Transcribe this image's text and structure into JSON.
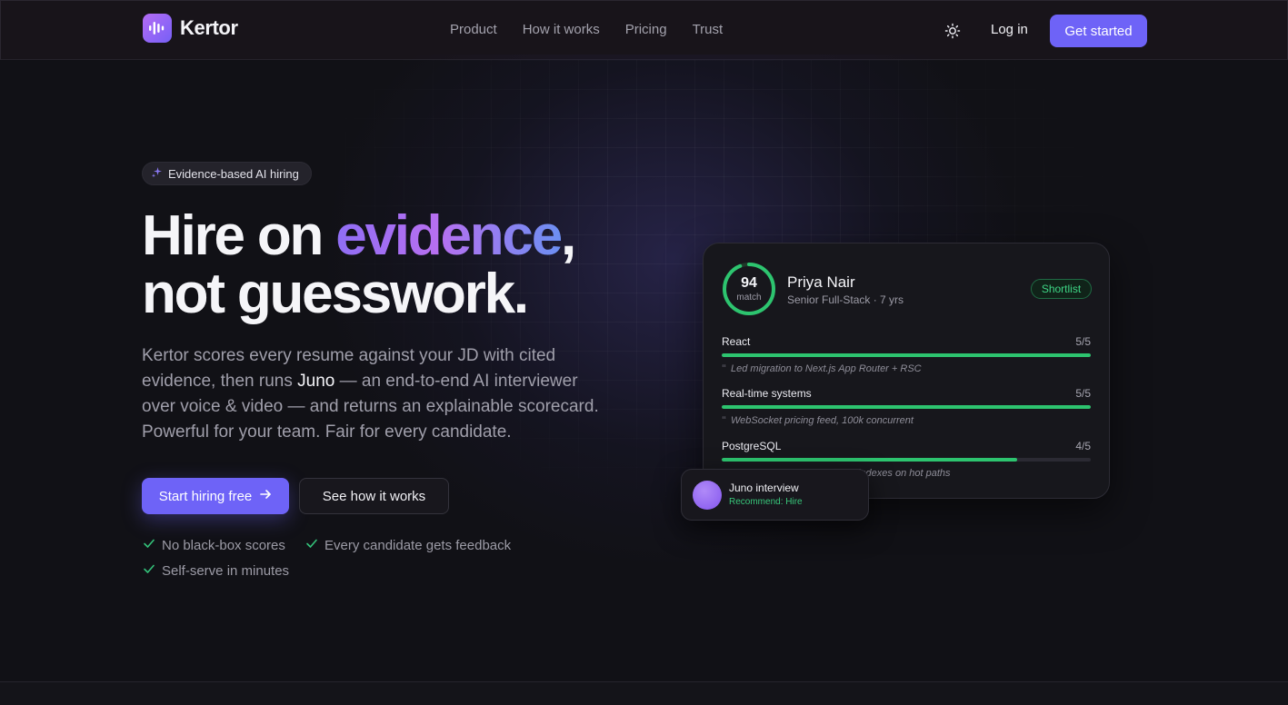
{
  "brand": {
    "name": "Kertor"
  },
  "nav": {
    "links": [
      "Product",
      "How it works",
      "Pricing",
      "Trust"
    ],
    "login": "Log in",
    "cta": "Get started"
  },
  "hero": {
    "badge": "Evidence-based AI hiring",
    "headline": {
      "part1": "Hire on ",
      "highlight": "evidence",
      "part2": ",",
      "line2": "not guesswork."
    },
    "lede": {
      "before": "Kertor scores every resume against your JD with cited evidence, then runs ",
      "strong": "Juno",
      "after": " — an end-to-end AI interviewer over voice & video — and returns an explainable scorecard. Powerful for your team. Fair for every candidate."
    },
    "primary_cta": "Start hiring free",
    "secondary_cta": "See how it works",
    "checks": [
      "No black-box scores",
      "Every candidate gets feedback",
      "Self-serve in minutes"
    ]
  },
  "scorecard": {
    "score": "94",
    "score_fraction": 0.94,
    "score_label": "match",
    "name": "Priya Nair",
    "role": "Senior Full-Stack · 7 yrs",
    "status": "Shortlist",
    "skills": [
      {
        "name": "React",
        "score": "5/5",
        "fraction": 1.0,
        "evidence": "Led migration to Next.js App Router + RSC"
      },
      {
        "name": "Real-time systems",
        "score": "5/5",
        "fraction": 1.0,
        "evidence": "WebSocket pricing feed, 100k concurrent"
      },
      {
        "name": "PostgreSQL",
        "score": "4/5",
        "fraction": 0.8,
        "evidence": "indexes on hot paths"
      }
    ]
  },
  "juno_card": {
    "title": "Juno interview",
    "recommendation": "Recommend: Hire"
  },
  "colors": {
    "accent": "#6e63f7",
    "success": "#2dc46f",
    "background": "#111116"
  },
  "icons": {
    "logo": "audio-bars-icon",
    "theme": "sun-icon",
    "badge": "sparkle-icon",
    "cta": "arrow-right-icon",
    "check": "check-icon",
    "evidence": "quote-icon"
  }
}
